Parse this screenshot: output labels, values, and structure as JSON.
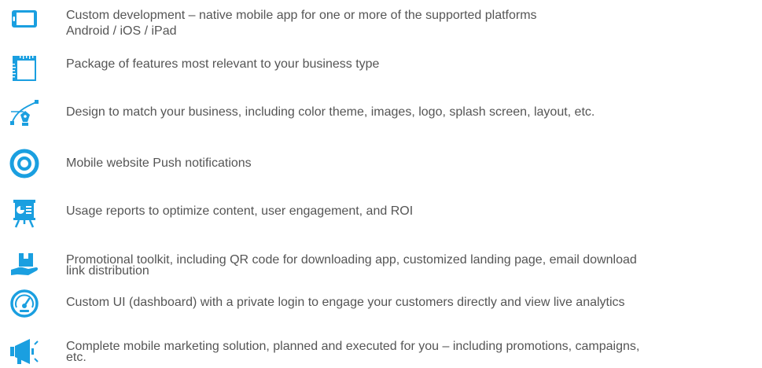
{
  "accent_color": "#1a9fe0",
  "features": [
    {
      "icon": "tablet-icon",
      "lines": [
        "Custom development – native mobile app for one or more of the supported platforms",
        "Android / iOS / iPad"
      ]
    },
    {
      "icon": "ruler-icon",
      "lines": [
        "Package of features most relevant to your business type"
      ]
    },
    {
      "icon": "pen-tool-icon",
      "lines": [
        "Design to match your business, including color theme, images, logo, splash screen, layout, etc."
      ]
    },
    {
      "icon": "ring-icon",
      "lines": [
        "Mobile website Push notifications"
      ]
    },
    {
      "icon": "presentation-board-icon",
      "lines": [
        "Usage reports to optimize content, user engagement, and ROI"
      ]
    },
    {
      "icon": "package-hand-icon",
      "lines": [
        "Promotional toolkit, including QR code for downloading app, customized landing page, email download",
        "link distribution"
      ]
    },
    {
      "icon": "speedometer-icon",
      "lines": [
        "Custom UI (dashboard) with a private login to engage your customers directly and view live analytics"
      ]
    },
    {
      "icon": "megaphone-icon",
      "lines": [
        "Complete mobile marketing solution, planned and executed for you – including promotions, campaigns,",
        "etc."
      ]
    }
  ]
}
